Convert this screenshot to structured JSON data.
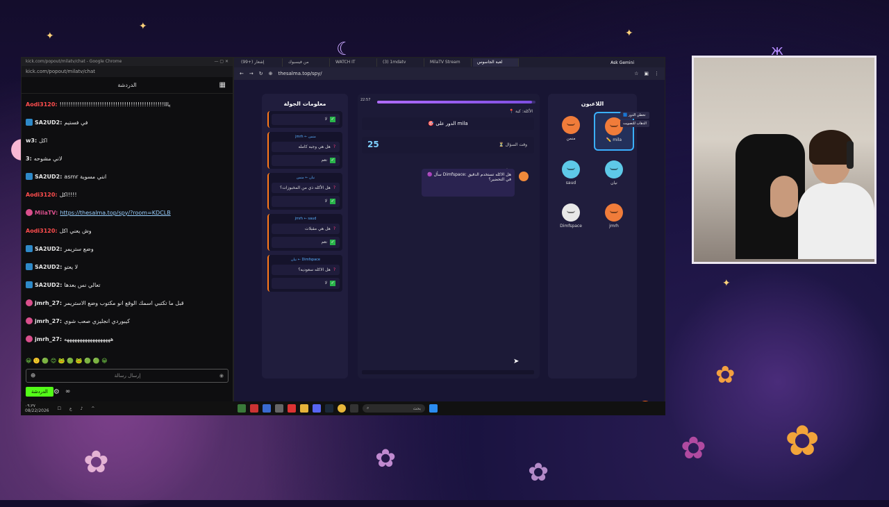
{
  "chat_window": {
    "title": "kick.com/popout/milatv/chat - Google Chrome",
    "url": "kick.com/popout/milatv/chat",
    "header": "الدردشة",
    "messages": [
      {
        "user": "Aodi3120:",
        "text": "!!!!!!!!!!!!!!!!!!!!!!!!!!!!!!!!!!!!!!!!!!!!!!!يااا",
        "color": "#ff4d4d",
        "badge": "none"
      },
      {
        "user": "SA2UD2:",
        "text": "في فستيم",
        "color": "#e6e6e6",
        "badge": "blue"
      },
      {
        "user": "w3:",
        "text": "اكل",
        "color": "#e6e6e6",
        "badge": "none"
      },
      {
        "user": "3:",
        "text": "لاني مشوحه",
        "color": "#e6e6e6",
        "badge": "none"
      },
      {
        "user": "SA2UD2:",
        "text": "asmr انني مسوية",
        "color": "#e6e6e6",
        "badge": "blue"
      },
      {
        "user": "Aodi3120:",
        "text": "اكل!!!!",
        "color": "#ff4d4d",
        "badge": "none"
      },
      {
        "user": "MilaTV:",
        "text": "https://thesalma.top/spy/?room=KDCLB",
        "color": "#d94f8c",
        "badge": "pink",
        "link": true
      },
      {
        "user": "Aodi3120:",
        "text": "وش يعني اكل",
        "color": "#ff4d4d",
        "badge": "none"
      },
      {
        "user": "SA2UD2:",
        "text": "وضع ستريمر",
        "color": "#e6e6e6",
        "badge": "blue"
      },
      {
        "user": "SA2UD2:",
        "text": "لا يعتو",
        "color": "#e6e6e6",
        "badge": "blue"
      },
      {
        "user": "SA2UD2:",
        "text": "تعالي نس بعدها",
        "color": "#e6e6e6",
        "badge": "blue"
      },
      {
        "user": "jmrh_27:",
        "text": "قبل ما تكتبي اسمك الوقع انو مكتوب وضع الاستريمر",
        "color": "#e6e6e6",
        "badge": "pink"
      },
      {
        "user": "jmrh_27:",
        "text": "كيبوردي انجليزي صعب شوي",
        "color": "#e6e6e6",
        "badge": "pink"
      },
      {
        "user": "jmrh_27:",
        "text": "ههههههههههههههههههه",
        "color": "#e6e6e6",
        "badge": "pink"
      }
    ],
    "emote_row": "😀 🙂 🟢 😊 🐸 🟢 🐸 🟢 🟢 😀",
    "input_placeholder": "إرسال رسالة",
    "send_label": "الدردشة",
    "taskbar_time": "٠٩:٣٧",
    "taskbar_date": "08/22/2026"
  },
  "browser": {
    "tabs": [
      "(99+) إشعار",
      "من فيسبوك",
      "WATCH IT",
      "(3) 1mdatv",
      "MilaTV Stream",
      "لعبة الجاسوس"
    ],
    "active_tab": 5,
    "ask_gemini": "Ask Gemini",
    "url": "thesalma.top/spy/"
  },
  "game": {
    "round_panel_title": "معلومات الجولة",
    "players_panel_title": "اللاعبون",
    "progress": 0.98,
    "timer_small": "22:57",
    "category": "📍 الأكلة: كبة",
    "turn_text": "🎯 الدور على mila",
    "question_time_label": "⏳ وقت السؤال",
    "question_time_value": "25",
    "message_from": "mila",
    "message_text": "🟣 سأل Dimfspace: هل الاكله تستخدم الدقيق في التحضير؟",
    "qa_log": [
      {
        "names": "",
        "question": "",
        "answer": "لا"
      },
      {
        "names": "jmrh ← منمن",
        "question": "هل هي وجبه كامله",
        "answer": "نعم"
      },
      {
        "names": "نيان ← منمن",
        "question": "هل الأكله ذي من المخبوزات؟",
        "answer": "لا"
      },
      {
        "names": "jmrh ← saud",
        "question": "هل هي مقبلات",
        "answer": "نعم"
      },
      {
        "names": "نيان ← Dimfspace",
        "question": "هل الاكله سعوديه؟",
        "answer": "لا"
      }
    ],
    "players": [
      {
        "name": "✏️ mila",
        "color": "#f07c3a",
        "selected": true
      },
      {
        "name": "منمن",
        "color": "#f07c3a",
        "selected": false
      },
      {
        "name": "نيان",
        "color": "#5ec9e8",
        "selected": false
      },
      {
        "name": "saud",
        "color": "#5ec9e8",
        "selected": false
      },
      {
        "name": "jmrh",
        "color": "#f07c3a",
        "selected": false
      },
      {
        "name": "Dimfspace",
        "color": "#e8e8e8",
        "selected": false
      }
    ],
    "vote_buttons": [
      "🟦 تخطي الدور",
      "الذهاب للتصويت"
    ],
    "fab_icon": "hand-icon"
  },
  "taskbar": {
    "search_label": "بحث"
  },
  "colors": {
    "accent_purple": "#9b5cff",
    "kick_green": "#53fc18",
    "qa_border": "#ff7a1a"
  }
}
